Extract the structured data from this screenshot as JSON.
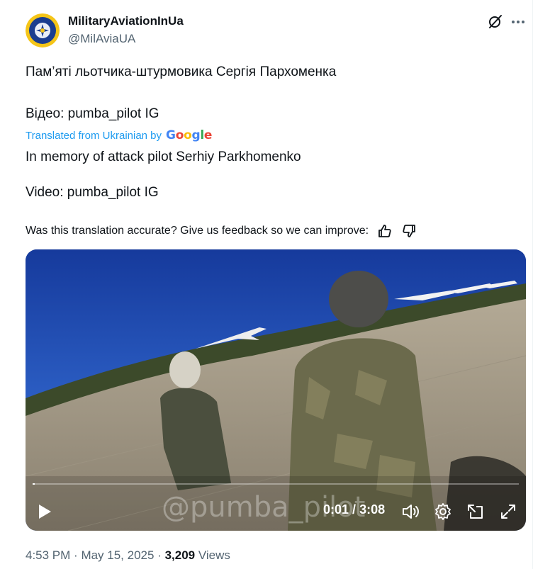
{
  "post": {
    "author": {
      "display_name": "MilitaryAviationInUa",
      "handle": "@MilAviaUA"
    },
    "original_text": {
      "line1": "Пам’яті льотчика-штурмовика Сергія Пархоменка",
      "line2": "Відео: pumba_pilot IG"
    },
    "translation": {
      "label": "Translated from Ukrainian by",
      "provider": "Google",
      "line1": "In memory of attack pilot Serhiy Parkhomenko",
      "line2": "Video: pumba_pilot IG"
    },
    "feedback": {
      "prompt": "Was this translation accurate? Give us feedback so we can improve:"
    },
    "video": {
      "watermark": "@pumba_pilot",
      "current_time": "0:01",
      "duration": "3:08",
      "progress_fraction": 0.005
    },
    "meta": {
      "time": "4:53 PM",
      "date": "May 15, 2025",
      "views_count": "3,209",
      "views_label": "Views"
    }
  },
  "icons": {
    "grok": "grok-icon",
    "more": "more-icon",
    "thumbs_up": "thumbs-up-icon",
    "thumbs_down": "thumbs-down-icon",
    "play": "play-icon",
    "volume": "volume-icon",
    "settings": "settings-gear-icon",
    "pop_out": "pop-out-icon",
    "fullscreen": "fullscreen-icon"
  },
  "colors": {
    "link_blue": "#1d9bf0",
    "secondary_text": "#536471",
    "primary_text": "#0f1419"
  }
}
